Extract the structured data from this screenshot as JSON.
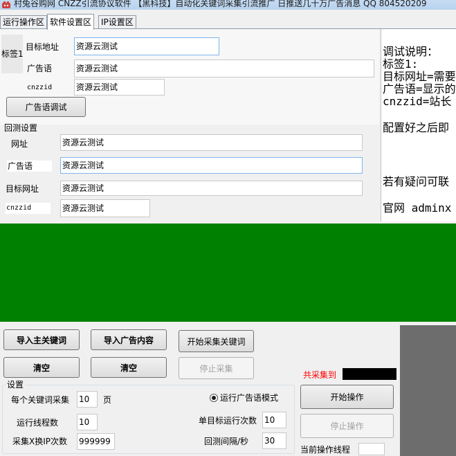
{
  "window": {
    "title": "村兔谷购网 CNZZ引流协议软件 【黑科技】自动化关键词采集引流推广 日推送几十万广告消息  QQ 804520209"
  },
  "tabs": [
    {
      "label": "运行操作区",
      "active": false
    },
    {
      "label": "软件设置区",
      "active": true
    },
    {
      "label": "IP设置区",
      "active": false
    }
  ],
  "tag_section": {
    "tag_label": "标签1",
    "target_address_label": "目标地址",
    "target_address_value": "资源云测试",
    "ad_label": "广告语",
    "ad_value": "资源云测试",
    "cnzzid_label": "cnzzid",
    "cnzzid_value": "资源云测试",
    "test_button": "广告语调试"
  },
  "huice": {
    "title": "回测设置",
    "url_label": "网址",
    "url_value": "资源云测试",
    "ad_label": "广告语",
    "ad_value": "资源云测试",
    "target_url_label": "目标网址",
    "target_url_value": "资源云测试",
    "cnzzid_label": "cnzzid",
    "cnzzid_value": "资源云测试"
  },
  "help": {
    "lines": [
      "调试说明：",
      "标签1:",
      "目标网址=需要",
      "广告语=显示的",
      "cnzzid=站长",
      "配置好之后即",
      "若有疑问可联",
      "官网 adminx"
    ]
  },
  "actions": {
    "import_keywords": "导入主关键词",
    "import_ads": "导入广告内容",
    "start_collect": "开始采集关键词",
    "clear_1": "清空",
    "clear_2": "清空",
    "stop_collect": "停止采集"
  },
  "settings": {
    "title": "设置",
    "per_keyword_label": "每个关键词采集",
    "per_keyword_value": "10",
    "per_keyword_unit": "页",
    "threads_label": "运行线程数",
    "threads_value": "10",
    "ip_switch_label": "采集X换IP次数",
    "ip_switch_value": "999999",
    "run_ad_mode_label": "运行广告语模式",
    "single_target_label": "单目标运行次数",
    "single_target_value": "10",
    "huice_interval_label": "回测间隔/秒",
    "huice_interval_value": "30"
  },
  "run_panel": {
    "collected_label": "共采集到",
    "collected_value": "",
    "start_button": "开始操作",
    "stop_button": "停止操作",
    "current_thread_label": "当前操作线程",
    "current_thread_value": ""
  },
  "colors": {
    "green_panel": "#008000",
    "accent_red": "#ff0000",
    "dark_panel": "#6d6d6d"
  }
}
